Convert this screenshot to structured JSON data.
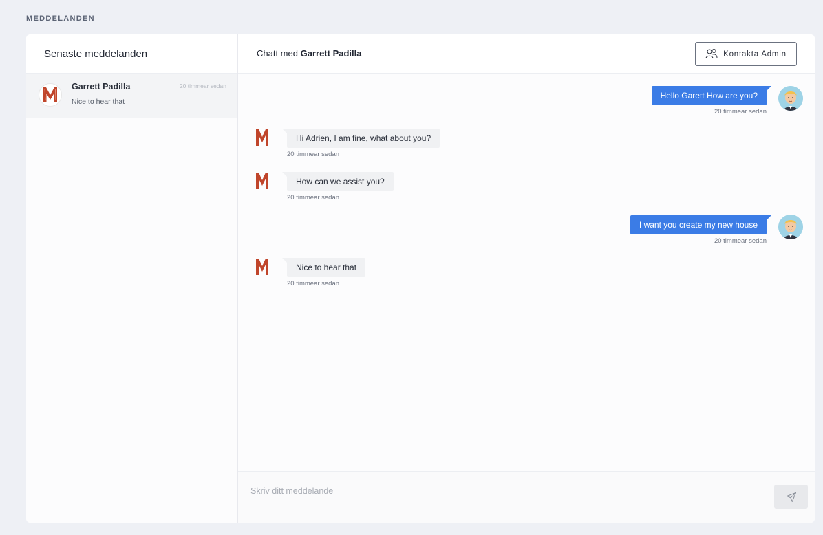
{
  "page": {
    "section_title": "MEDDELANDEN"
  },
  "sidebar": {
    "title": "Senaste meddelanden",
    "conversations": [
      {
        "name": "Garrett Padilla",
        "preview": "Nice to hear that",
        "time": "20 timmear sedan",
        "avatar": "m-logo-avatar"
      }
    ]
  },
  "chat": {
    "title_prefix": "Chatt med",
    "title_name": "Garrett Padilla",
    "contact_admin_label": "Kontakta Admin",
    "messages": [
      {
        "direction": "out",
        "text": "Hello Garett How are you?",
        "time": "20 timmear sedan"
      },
      {
        "direction": "in",
        "text": "Hi Adrien, I am fine, what about you?",
        "time": "20 timmear sedan"
      },
      {
        "direction": "in",
        "text": "How can we assist you?",
        "time": "20 timmear sedan"
      },
      {
        "direction": "out",
        "text": "I want you create my new house",
        "time": "20 timmear sedan"
      },
      {
        "direction": "in",
        "text": "Nice to hear that",
        "time": "20 timmear sedan"
      }
    ]
  },
  "composer": {
    "placeholder": "Skriv ditt meddelande",
    "value": ""
  },
  "colors": {
    "accent": "#3b7ce6",
    "background": "#eef0f5",
    "incoming_bubble": "#f0f1f3",
    "m_logo": "#c0452b"
  },
  "icons": {
    "admin": "users-icon",
    "send": "send-icon"
  }
}
